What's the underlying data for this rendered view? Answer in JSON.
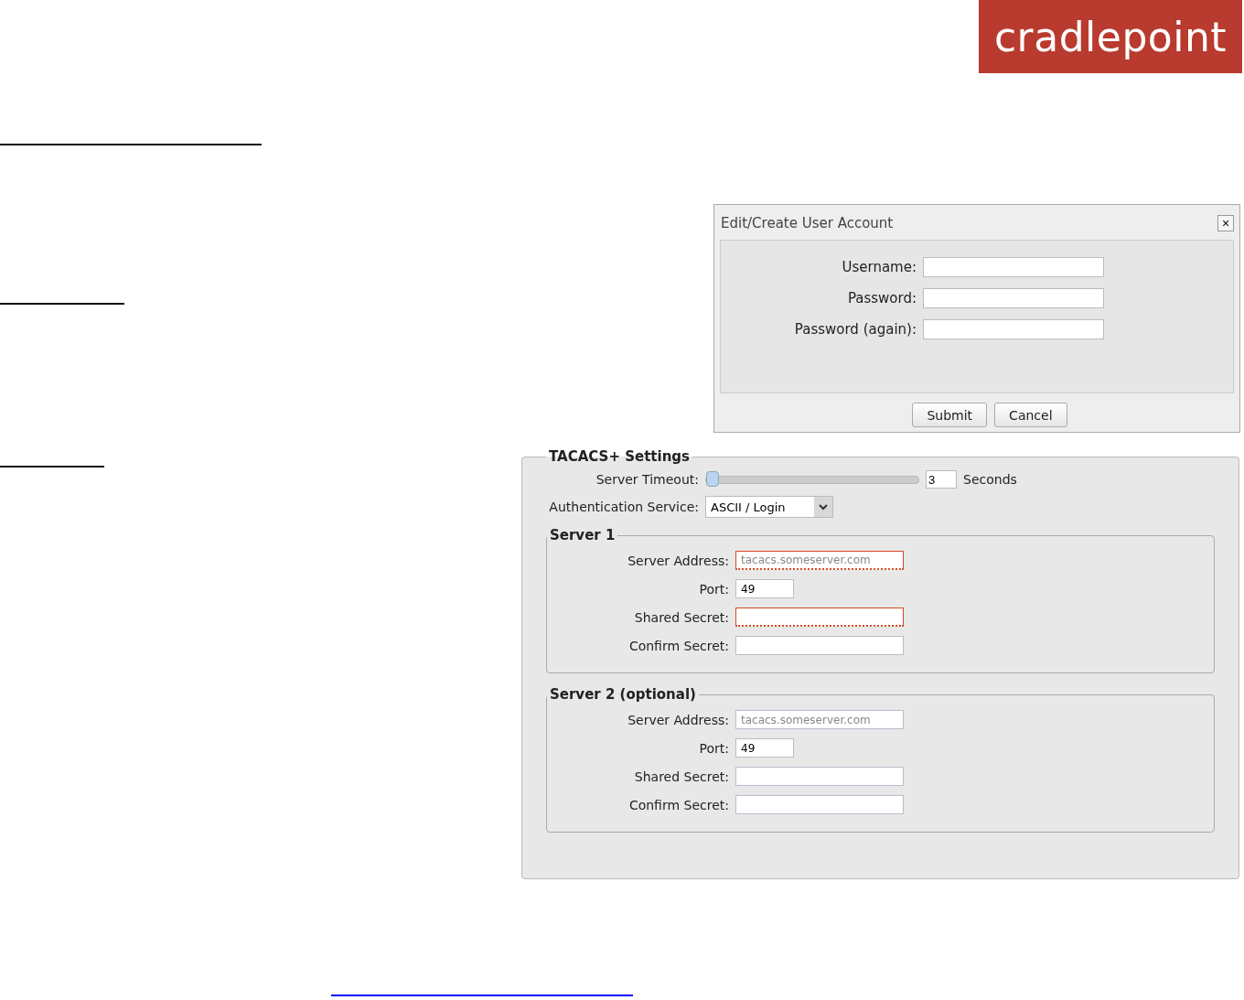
{
  "logo": {
    "text": "cradlepoint"
  },
  "dialog": {
    "title": "Edit/Create User Account",
    "close": "×",
    "fields": [
      {
        "label": "Username:"
      },
      {
        "label": "Password:"
      },
      {
        "label": "Password (again):"
      }
    ],
    "buttons": [
      "Submit",
      "Cancel"
    ]
  },
  "tacacs": {
    "title": "TACACS+ Settings",
    "timeout": {
      "label": "Server Timeout:",
      "level": 0,
      "value": "3",
      "unit": "Seconds"
    },
    "auth": {
      "label": "Authentication Service:",
      "value": "ASCII / Login"
    },
    "servers": [
      {
        "title": "Server 1",
        "fields": [
          {
            "label": "Server Address:",
            "kind": "text",
            "placeholder": "tacacs.someserver.com",
            "invalid": true
          },
          {
            "label": "Port:",
            "kind": "port",
            "value": "49",
            "invalid": false
          },
          {
            "label": "Shared Secret:",
            "kind": "text",
            "invalid": true
          },
          {
            "label": "Confirm Secret:",
            "kind": "text",
            "invalid": false
          }
        ]
      },
      {
        "title": "Server 2 (optional)",
        "fields": [
          {
            "label": "Server Address:",
            "kind": "text",
            "placeholder": "tacacs.someserver.com",
            "invalid": false
          },
          {
            "label": "Port:",
            "kind": "port",
            "value": "49",
            "invalid": false
          },
          {
            "label": "Shared Secret:",
            "kind": "text",
            "invalid": false
          },
          {
            "label": "Confirm Secret:",
            "kind": "text",
            "invalid": false
          }
        ]
      }
    ]
  }
}
